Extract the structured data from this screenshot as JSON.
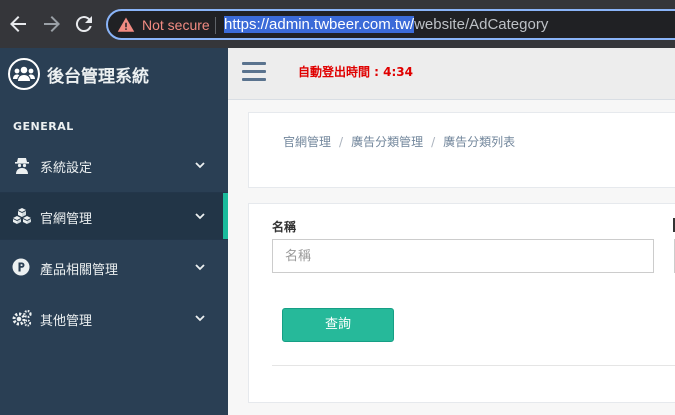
{
  "browser": {
    "security_label": "Not secure",
    "url_selected": "https://admin.twbeer.com.tw/",
    "url_rest": "website/AdCategory"
  },
  "sidebar": {
    "brand_title": "後台管理系統",
    "section_label": "GENERAL",
    "items": [
      {
        "label": "系統設定",
        "icon": "user-secret-icon",
        "active": false
      },
      {
        "label": "官網管理",
        "icon": "cubes-icon",
        "active": true
      },
      {
        "label": "產品相關管理",
        "icon": "product-p-icon",
        "active": false
      },
      {
        "label": "其他管理",
        "icon": "gears-icon",
        "active": false
      }
    ]
  },
  "topbar": {
    "logout_timer": "自動登出時間 : 4:34"
  },
  "breadcrumb": [
    "官網管理",
    "廣告分類管理",
    "廣告分類列表"
  ],
  "form": {
    "name_label": "名稱",
    "name_placeholder": "名稱",
    "search_button": "查詢"
  },
  "colors": {
    "sidebar_bg": "#2a3f54",
    "accent": "#1abb9c",
    "button": "#26b99a",
    "timer": "#e00000"
  }
}
